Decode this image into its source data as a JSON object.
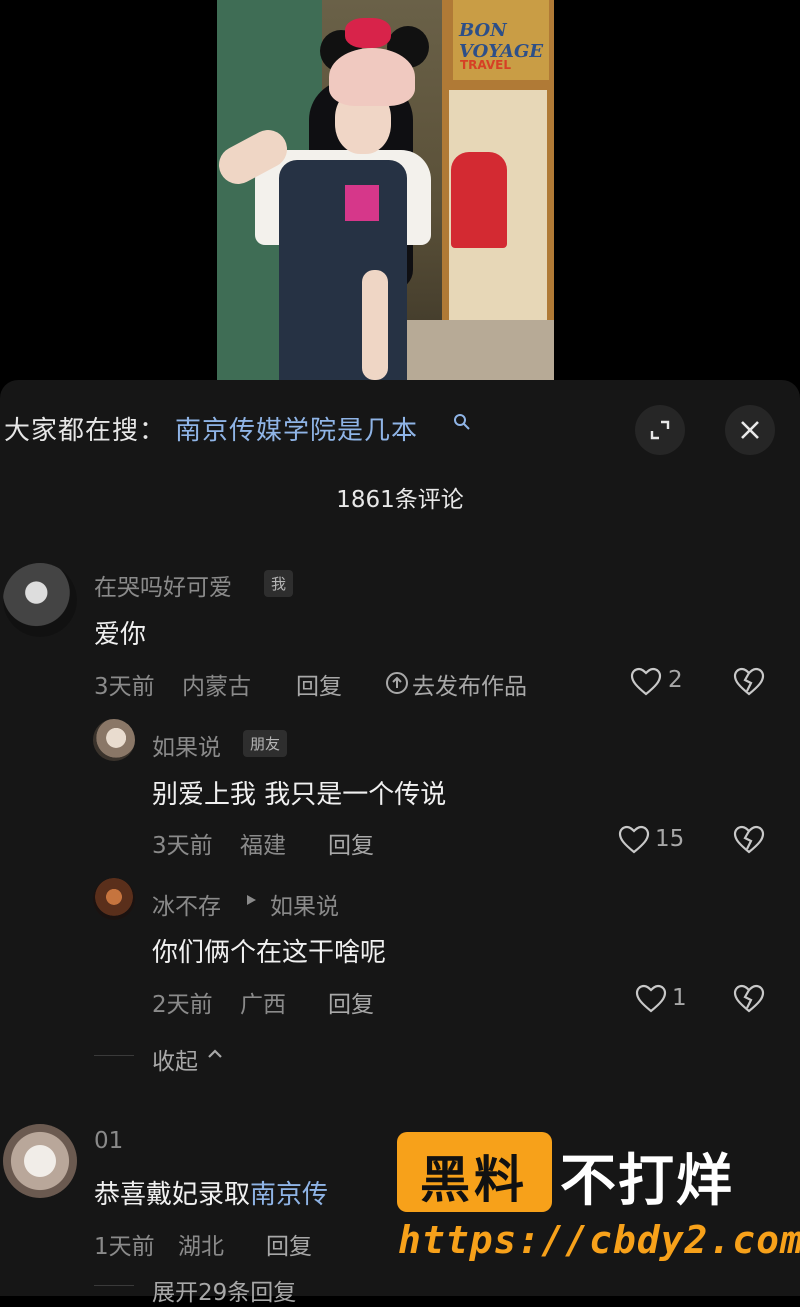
{
  "video": {
    "sign_text": "BON VOYAGE",
    "sign_sub": "TRAVEL"
  },
  "search": {
    "prefix": "大家都在搜：",
    "query": "南京传媒学院是几本"
  },
  "comments_header": {
    "count_text": "1861条评论"
  },
  "comments": [
    {
      "username": "在哭吗好可爱",
      "badge": "我",
      "text": "爱你",
      "time": "3天前",
      "location": "内蒙古",
      "reply_label": "回复",
      "publish_label": "去发布作品",
      "likes": "2",
      "replies": [
        {
          "username": "如果说",
          "badge": "朋友",
          "text": "别爱上我 我只是一个传说",
          "time": "3天前",
          "location": "福建",
          "reply_label": "回复",
          "likes": "15"
        },
        {
          "username": "冰不存",
          "reply_to": "如果说",
          "text": "你们俩个在这干啥呢",
          "time": "2天前",
          "location": "广西",
          "reply_label": "回复",
          "likes": "1"
        }
      ],
      "collapse_label": "收起"
    },
    {
      "username": "01",
      "text_prefix": "恭喜戴妃录取",
      "text_link": "南京传",
      "time": "1天前",
      "location": "湖北",
      "reply_label": "回复",
      "expand_label": "展开29条回复"
    }
  ],
  "watermark": {
    "dark_text": "黑料",
    "light_text": "不打烊",
    "url": "https://cbdy2.com"
  },
  "colors": {
    "panel_bg": "#161616",
    "link": "#8fb4e6",
    "muted": "#8a8a8a",
    "watermark_orange": "#f7a11a"
  }
}
